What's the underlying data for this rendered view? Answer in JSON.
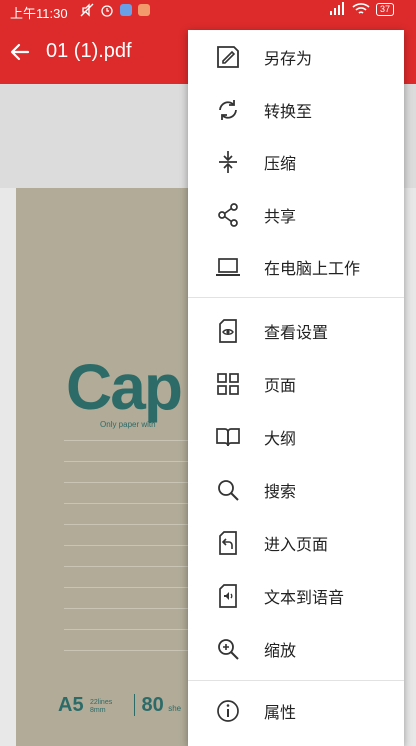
{
  "status_bar": {
    "time": "上午11:30",
    "battery": "37"
  },
  "toolbar": {
    "title": "01 (1).pdf"
  },
  "document": {
    "cover_brand": "Cap",
    "cover_subtitle": "Only paper with",
    "cover_size": "A5",
    "cover_size_detail": "22lines 8mm",
    "cover_sheets": "80",
    "cover_sheets_label": "she"
  },
  "menu": {
    "items": [
      {
        "label": "另存为",
        "icon": "save-as-icon"
      },
      {
        "label": "转换至",
        "icon": "convert-icon"
      },
      {
        "label": "压缩",
        "icon": "compress-icon"
      },
      {
        "label": "共享",
        "icon": "share-icon"
      },
      {
        "label": "在电脑上工作",
        "icon": "laptop-icon"
      },
      {
        "label": "查看设置",
        "icon": "view-settings-icon"
      },
      {
        "label": "页面",
        "icon": "pages-grid-icon"
      },
      {
        "label": "大纲",
        "icon": "outline-book-icon"
      },
      {
        "label": "搜索",
        "icon": "search-icon"
      },
      {
        "label": "进入页面",
        "icon": "go-to-page-icon"
      },
      {
        "label": "文本到语音",
        "icon": "text-to-speech-icon"
      },
      {
        "label": "缩放",
        "icon": "zoom-icon"
      },
      {
        "label": "属性",
        "icon": "info-icon"
      }
    ]
  },
  "colors": {
    "app_bar": "#dd2b2b",
    "menu_bg": "#ffffff",
    "icon": "#333333"
  }
}
